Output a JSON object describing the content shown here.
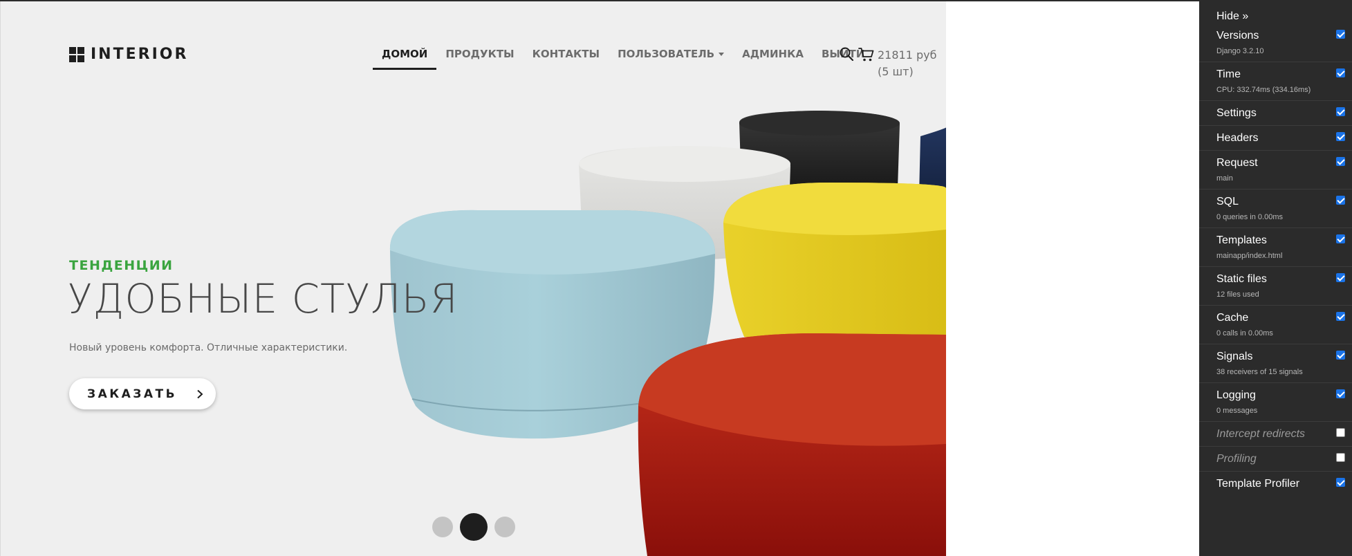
{
  "site": {
    "logo_text": "INTERIOR",
    "nav": [
      {
        "label": "ДОМОЙ",
        "active": true
      },
      {
        "label": "ПРОДУКТЫ"
      },
      {
        "label": "КОНТАКТЫ"
      },
      {
        "label": "ПОЛЬЗОВАТЕЛЬ",
        "dropdown": true
      },
      {
        "label": "АДМИНКА"
      },
      {
        "label": "ВЫЙТИ"
      }
    ],
    "cart": {
      "amount": "21811 руб",
      "count": "(5 шт)"
    }
  },
  "hero": {
    "eyebrow": "ТЕНДЕНЦИИ",
    "headline": "УДОБНЫЕ СТУЛЬЯ",
    "subtext": "Новый уровень комфорта. Отличные характеристики.",
    "cta_label": "ЗАКАЗАТЬ",
    "slides_total": 3,
    "slide_active": 2,
    "colors": {
      "accent": "#3aa43f",
      "dark": "#1e1e1e",
      "background": "#efefef"
    }
  },
  "debug_toolbar": {
    "hide_label": "Hide »",
    "panels": [
      {
        "title": "Versions",
        "subtitle": "Django 3.2.10",
        "checked": true
      },
      {
        "title": "Time",
        "subtitle": "CPU: 332.74ms (334.16ms)",
        "checked": true
      },
      {
        "title": "Settings",
        "subtitle": "",
        "checked": true
      },
      {
        "title": "Headers",
        "subtitle": "",
        "checked": true
      },
      {
        "title": "Request",
        "subtitle": "main",
        "checked": true
      },
      {
        "title": "SQL",
        "subtitle": "0 queries in 0.00ms",
        "checked": true
      },
      {
        "title": "Templates",
        "subtitle": "mainapp/index.html",
        "checked": true
      },
      {
        "title": "Static files",
        "subtitle": "12 files used",
        "checked": true
      },
      {
        "title": "Cache",
        "subtitle": "0 calls in 0.00ms",
        "checked": true
      },
      {
        "title": "Signals",
        "subtitle": "38 receivers of 15 signals",
        "checked": true
      },
      {
        "title": "Logging",
        "subtitle": "0 messages",
        "checked": true
      },
      {
        "title": "Intercept redirects",
        "subtitle": "",
        "checked": false
      },
      {
        "title": "Profiling",
        "subtitle": "",
        "checked": false
      },
      {
        "title": "Template Profiler",
        "subtitle": "",
        "checked": true
      }
    ]
  }
}
